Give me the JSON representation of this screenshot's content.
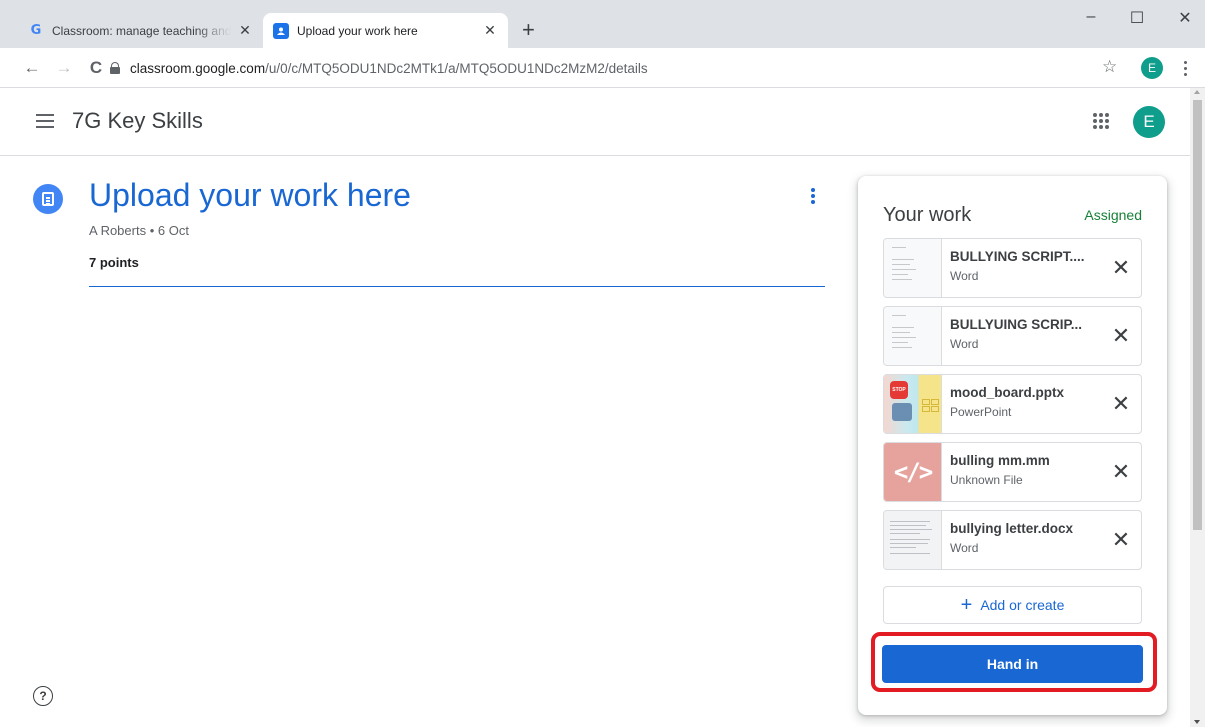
{
  "browser": {
    "tabs": [
      {
        "title": "Classroom: manage teaching and",
        "icon": "google-g-icon"
      },
      {
        "title": "Upload your work here",
        "icon": "classroom-icon"
      }
    ],
    "new_tab_label": "+",
    "url_domain": "classroom.google.com",
    "url_path": "/u/0/c/MTQ5ODU1NDc2MTk1/a/MTQ5ODU1NDc2MzM2/details",
    "profile_initial": "E",
    "window_controls": {
      "minimize": "–",
      "maximize": "☐",
      "close": "✕"
    },
    "nav": {
      "back": "←",
      "forward": "→",
      "reload": "C",
      "bookmark": "☆"
    }
  },
  "app": {
    "class_name": "7G Key Skills",
    "profile_initial": "E"
  },
  "assignment": {
    "title": "Upload your work here",
    "meta": "A Roberts • 6 Oct",
    "points": "7 points",
    "help": "?"
  },
  "work": {
    "heading": "Your work",
    "status": "Assigned",
    "attachments": [
      {
        "name": "BULLYING SCRIPT....",
        "type": "Word",
        "thumb": "word-doc"
      },
      {
        "name": "BULLYUING SCRIP...",
        "type": "Word",
        "thumb": "word-doc"
      },
      {
        "name": "mood_board.pptx",
        "type": "PowerPoint",
        "thumb": "powerpoint"
      },
      {
        "name": "bulling mm.mm",
        "type": "Unknown File",
        "thumb": "code-file"
      },
      {
        "name": "bullying letter.docx",
        "type": "Word",
        "thumb": "word-letter"
      }
    ],
    "remove_label": "✕",
    "code_glyph": "</>",
    "stop_text": "STOP",
    "add_label": "Add or create",
    "add_icon": "+",
    "hand_in_label": "Hand in"
  },
  "colors": {
    "accent": "#1967d2",
    "assigned": "#188038",
    "highlight": "#e31c24",
    "avatar": "#0f9d8c"
  }
}
